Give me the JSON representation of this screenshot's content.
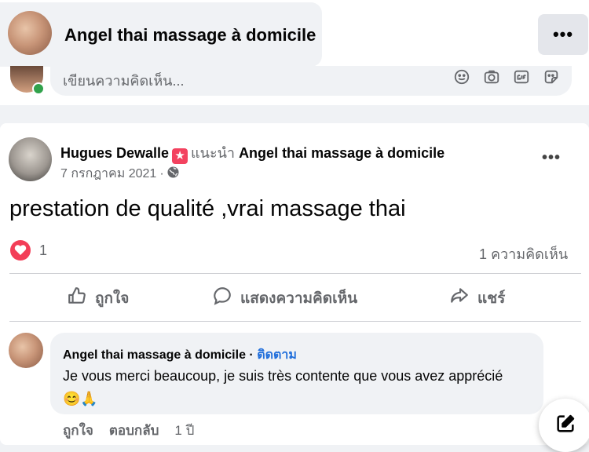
{
  "header": {
    "page_title": "Angel thai massage à domicile",
    "more_label": "•••"
  },
  "composer": {
    "placeholder": "เขียนความคิดเห็น..."
  },
  "post": {
    "author": "Hugues Dewalle",
    "recommends": "แนะนำ",
    "page_name": "Angel thai massage à domicile",
    "date": "7 กรกฎาคม 2021",
    "dot": "·",
    "more_label": "•••",
    "text": "prestation de qualité ,vrai massage thai",
    "reaction_count": "1",
    "comment_count": "1 ความคิดเห็น"
  },
  "actions": {
    "like": "ถูกใจ",
    "comment": "แสดงความคิดเห็น",
    "share": "แชร์"
  },
  "reply": {
    "author": "Angel thai massage à domicile",
    "sep": "·",
    "follow": "ติดตาม",
    "text": "Je vous merci beaucoup, je suis très contente que vous avez apprécié 😊🙏",
    "like": "ถูกใจ",
    "reply": "ตอบกลับ",
    "age": "1 ปี"
  },
  "colors": {
    "brand_blue": "#216fdb",
    "heart_red": "#f33e58",
    "star_badge": "#f3425f",
    "online_green": "#31a24c"
  }
}
